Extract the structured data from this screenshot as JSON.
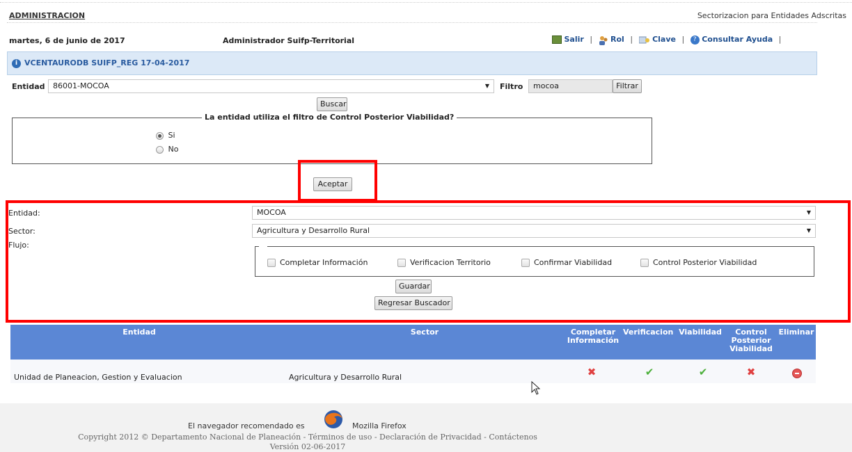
{
  "header": {
    "section_title": "ADMINISTRACION",
    "page_name": "Sectorizacion para Entidades Adscritas",
    "date": "martes, 6 de junio de 2017",
    "user_role": "Administrador Suifp-Territorial",
    "links": {
      "salir": "Salir",
      "rol": "Rol",
      "clave": "Clave",
      "ayuda": "Consultar Ayuda",
      "separator": "|"
    }
  },
  "info_bar": {
    "text": "VCENTAURODB SUIFP_REG 17-04-2017"
  },
  "search": {
    "entidad_label": "Entidad",
    "entidad_value": "86001-MOCOA",
    "filtro_label": "Filtro",
    "filtro_value": "mocoa",
    "filtrar_label": "Filtrar",
    "buscar_label": "Buscar"
  },
  "control_posterior": {
    "legend": "La entidad utiliza el filtro de Control Posterior Viabilidad?",
    "options": [
      "Si",
      "No"
    ],
    "selected": "Si",
    "aceptar_label": "Aceptar"
  },
  "form": {
    "entidad_label": "Entidad:",
    "entidad_value": "MOCOA",
    "sector_label": "Sector:",
    "sector_value": "Agricultura y Desarrollo Rural",
    "flujo_label": "Flujo:",
    "flujo_options": [
      "Completar Información",
      "Verificacion Territorio",
      "Confirmar Viabilidad",
      "Control Posterior Viabilidad"
    ],
    "guardar_label": "Guardar",
    "regresar_label": "Regresar Buscador"
  },
  "table": {
    "headers": {
      "entidad": "Entidad",
      "sector": "Sector",
      "completar": "Completar Información",
      "verificacion": "Verificacion",
      "viabilidad": "Viabilidad",
      "control": "Control Posterior Viabilidad",
      "eliminar": "Eliminar"
    },
    "rows": [
      {
        "entidad": "Unidad de Planeacion, Gestion y Evaluacion",
        "sector": "Agricultura y Desarrollo Rural",
        "completar": "cross-icon",
        "verificacion": "check-icon",
        "viabilidad": "check-icon",
        "control": "cross-icon",
        "eliminar": "delete-icon"
      }
    ]
  },
  "footer": {
    "browser_text": "El navegador recomendado es",
    "browser_name": "Mozilla Firefox",
    "copyright": "Copyright 2012 © Departamento Nacional de Planeación - Términos de uso - Declaración de Privacidad - Contáctenos",
    "version": "Versión 02-06-2017"
  },
  "colors": {
    "table_header": "#5b87d5",
    "info_bar": "#dce9f7",
    "highlight": "#ff0000",
    "footer_bg": "#f2f2f2"
  }
}
